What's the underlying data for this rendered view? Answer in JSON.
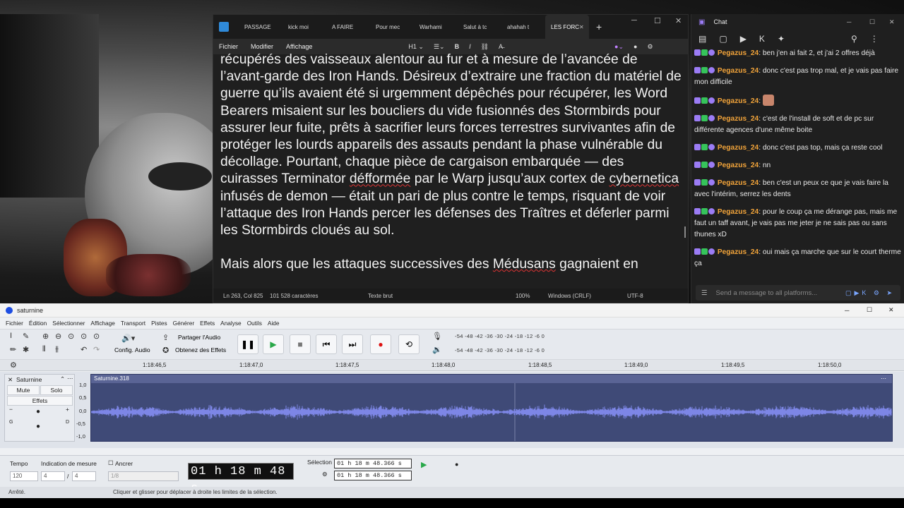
{
  "notepad": {
    "tabs": [
      "PASSAGE",
      "kick moi",
      "A FAIRE",
      "Pour mec",
      "Warhami",
      "Salut à tc",
      "ahahah t",
      "LES FORC"
    ],
    "menu": [
      "Fichier",
      "Modifier",
      "Affichage"
    ],
    "heading_tool": "H1",
    "paragraphs": [
      "récupérés des vaisseaux alentour au fur et à mesure de l’avancée de l’avant-garde des Iron Hands. Désireux d’extraire une fraction du matériel de guerre qu’ils avaient été si urgemment dépêchés pour récupérer, les Word Bearers misaient sur les boucliers du vide fusionnés des Stormbirds pour assurer leur fuite, prêts à sacrifier leurs forces terrestres survivantes afin de protéger les lourds appareils des assauts pendant la phase vulnérable du décollage. Pourtant, chaque pièce de cargaison embarquée — des cuirasses Terminator défformée par le Warp jusqu’aux cortex de cybernetica infusés de demon — était un pari de plus contre le temps, risquant de voir l’attaque des Iron Hands percer les défenses des Traîtres et déferler parmi les Stormbirds cloués au sol.",
      "Mais alors que les attaques successives des Médusans gagnaient en"
    ],
    "status": {
      "position": "Ln 263, Col 825",
      "chars": "101 528 caractères",
      "format": "Texte brut",
      "zoom": "100%",
      "eol": "Windows (CRLF)",
      "encoding": "UTF-8"
    }
  },
  "chat": {
    "title": "Chat",
    "messages": [
      {
        "user": "Pegazus_24",
        "text": "ben j'en ai fait 2, et j'ai 2 offres déjà"
      },
      {
        "user": "Pegazus_24",
        "text": "donc c'est pas trop mal, et je vais pas faire mon difficile"
      },
      {
        "user": "Pegazus_24",
        "text": ""
      },
      {
        "user": "Pegazus_24",
        "text": "c'est de l'install de soft et de pc sur différente agences d'une même boite"
      },
      {
        "user": "Pegazus_24",
        "text": "donc c'est pas top, mais ça reste cool"
      },
      {
        "user": "Pegazus_24",
        "text": "nn"
      },
      {
        "user": "Pegazus_24",
        "text": "ben c'est un peux ce que je vais faire la avec l'intérim, serrez les dents"
      },
      {
        "user": "Pegazus_24",
        "text": "pour le coup ça me dérange pas, mais me faut un taff avant, je vais pas me jeter je ne sais pas ou sans thunes xD"
      },
      {
        "user": "Pegazus_24",
        "text": "oui mais ça marche que sur le court therme ça"
      }
    ],
    "input_placeholder": "Send a message to all platforms..."
  },
  "audacity": {
    "title": "saturnine",
    "menu": [
      "Fichier",
      "Édition",
      "Sélectionner",
      "Affichage",
      "Transport",
      "Pistes",
      "Générer",
      "Effets",
      "Analyse",
      "Outils",
      "Aide"
    ],
    "audio_setup": "Config. Audio",
    "share_audio": "Partager l'Audio",
    "get_effects": "Obtenez des Effets",
    "meter_scale": "-54 -48 -42 -36 -30 -24 -18 -12 -6 0",
    "ruler": [
      "1:18:46,5",
      "1:18:47,0",
      "1:18:47,5",
      "1:18:48,0",
      "1:18:48,5",
      "1:18:49,0",
      "1:18:49,5",
      "1:18:50,0"
    ],
    "track": {
      "name": "Saturnine",
      "mute": "Mute",
      "solo": "Solo",
      "effects": "Effets",
      "clip_name": "Saturnine.318",
      "scale": [
        "1,0",
        "0,5",
        "0,0",
        "-0,5",
        "-1,0"
      ],
      "pan_l": "G",
      "pan_r": "D"
    },
    "bottom": {
      "tempo_label": "Tempo",
      "tempo": "120",
      "time_sig_label": "Indication de mesure",
      "time_sig_num": "4",
      "time_sig_den": "4",
      "snap_label": "Ancrer",
      "snap_value": "1/8",
      "time": "01 h 18 m 48 s",
      "selection_label": "Sélection",
      "sel_start": "01 h 18 m 48.366 s",
      "sel_end": "01 h 18 m 48.366 s"
    },
    "status_left": "Arrêté.",
    "status_hint": "Cliquer et glisser pour déplacer à droite les limites de la sélection."
  }
}
